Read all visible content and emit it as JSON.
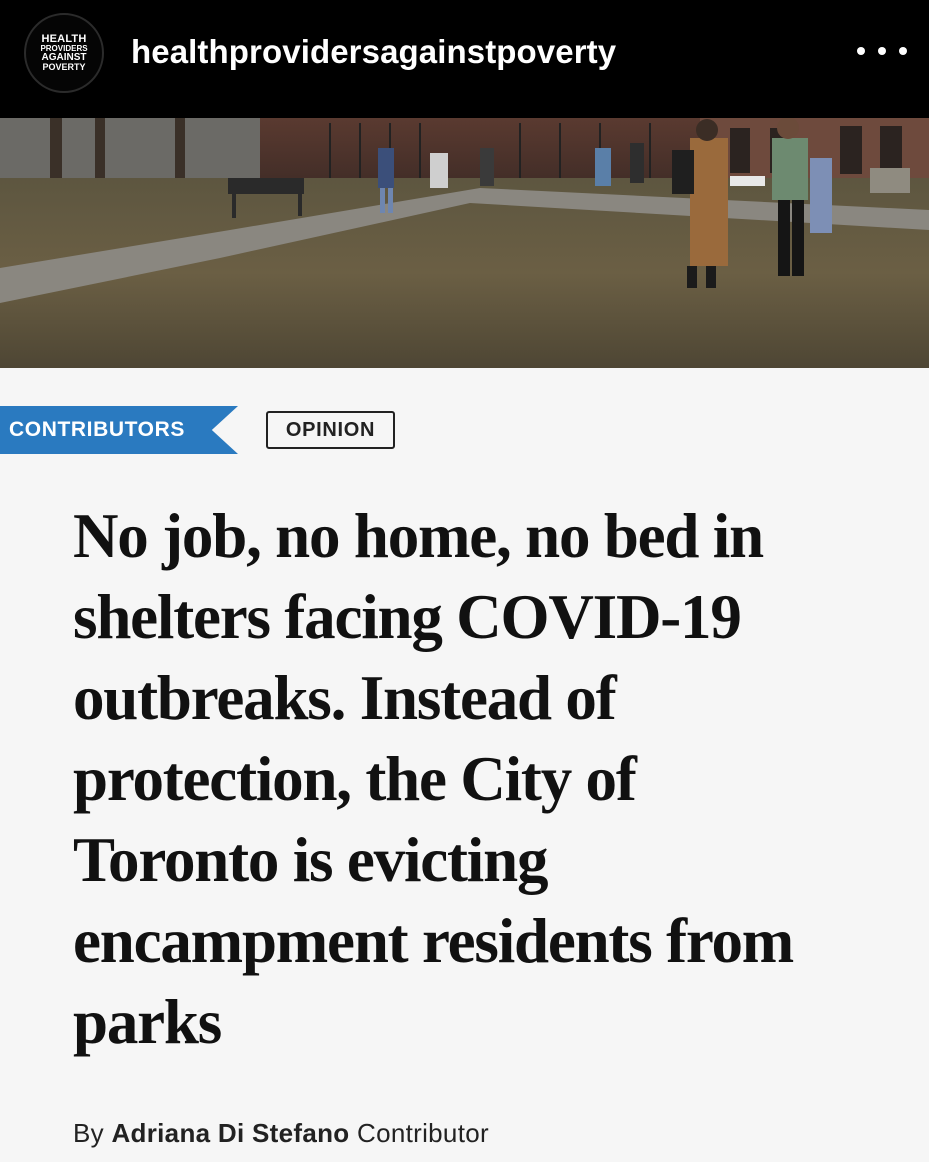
{
  "header": {
    "avatar_lines": [
      "HEALTH",
      "PROVIDERS",
      "AGAINST",
      "POVERTY"
    ],
    "username": "healthprovidersagainstpoverty",
    "more_icon": "more-horizontal-icon"
  },
  "article": {
    "section_tag": "CONTRIBUTORS",
    "category_tag": "OPINION",
    "headline_lines": [
      "No job, no home, no bed in",
      "shelters facing COVID-19",
      "outbreaks. Instead of",
      "protection, the City of",
      "Toronto is evicting",
      "encampment residents from",
      "parks"
    ],
    "byline_prefix": "By",
    "author": "Adriana Di Stefano",
    "author_role": "Contributor"
  },
  "colors": {
    "header_bg": "#000000",
    "tag_blue": "#2a7ac0",
    "page_bg": "#f6f6f6"
  }
}
